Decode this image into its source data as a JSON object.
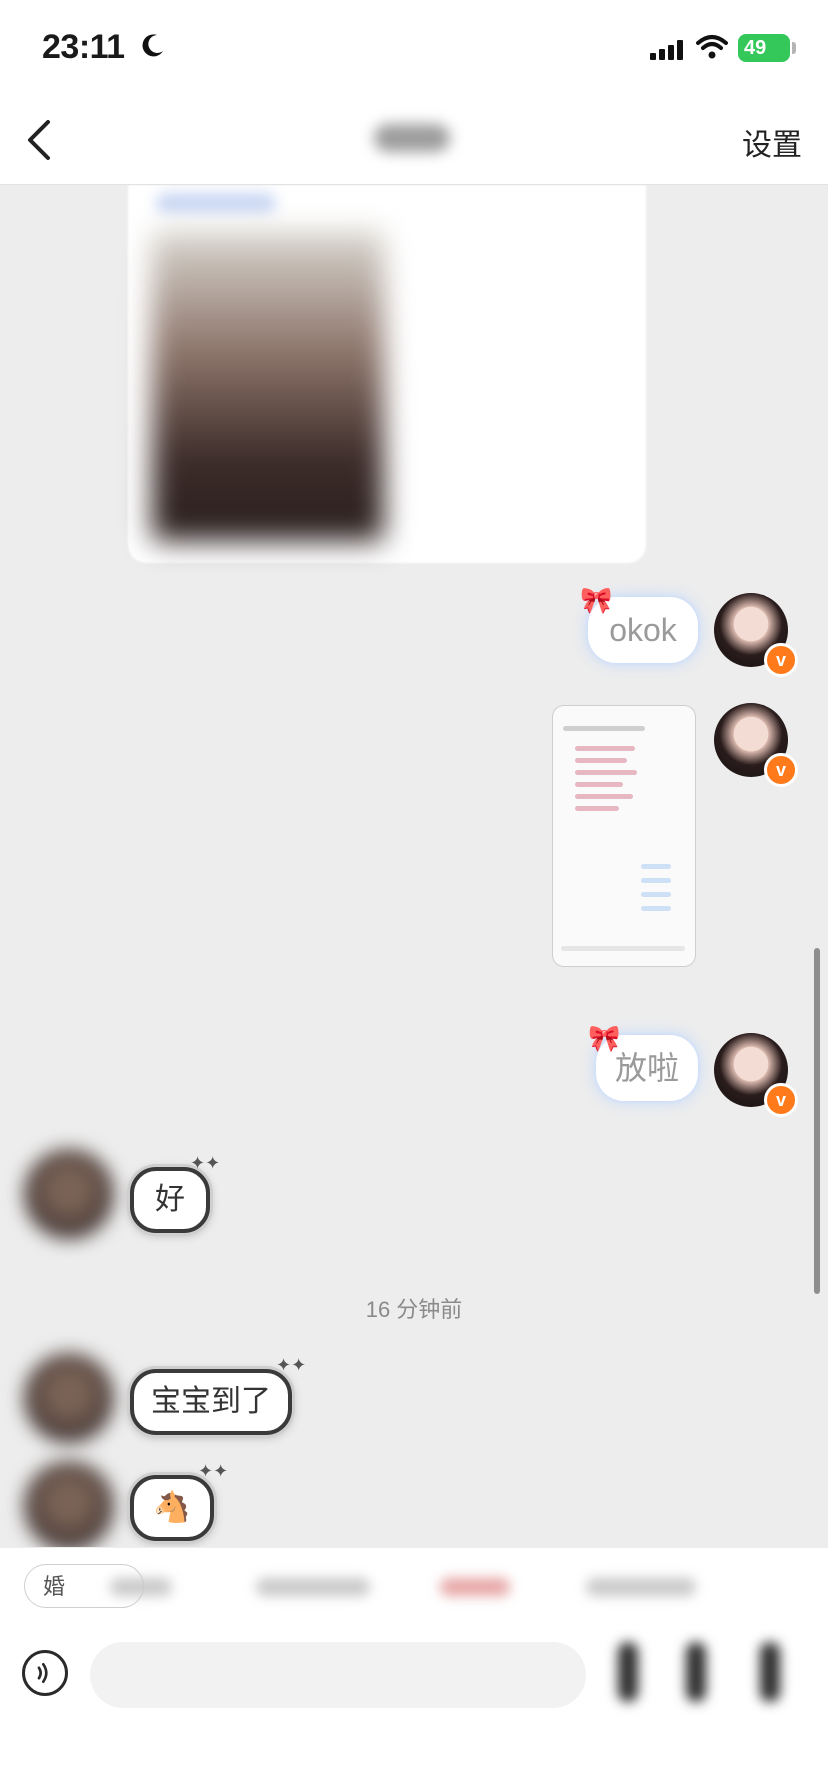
{
  "status_bar": {
    "time": "23:11",
    "battery": "49"
  },
  "nav": {
    "settings_label": "设置"
  },
  "messages": {
    "self_okok": "okok",
    "self_fangla": "放啦",
    "other_hao": "好",
    "other_baobao": "宝宝到了",
    "other_horse": "🐴"
  },
  "timestamp": "16 分钟前",
  "quick_bar": {
    "first_label": "婚"
  },
  "colors": {
    "accent_orange": "#ff7a1a",
    "battery_green": "#34c759",
    "chat_bg": "#ededed"
  }
}
